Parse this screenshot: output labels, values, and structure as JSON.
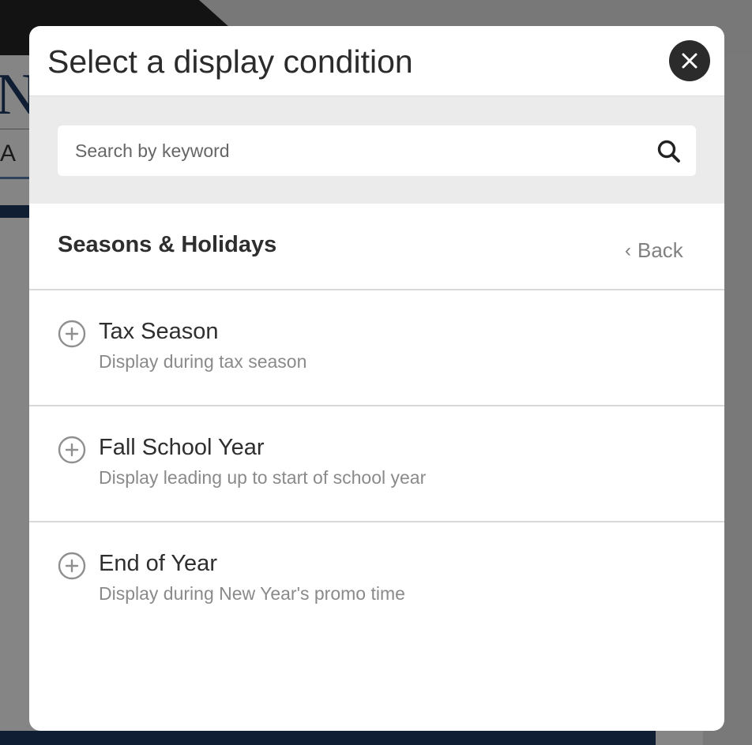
{
  "background": {
    "nav_letter": "A"
  },
  "modal": {
    "title": "Select a display condition",
    "close_icon": "close-icon",
    "search": {
      "placeholder": "Search by keyword",
      "value": "",
      "icon": "search-icon"
    },
    "section": {
      "title": "Seasons & Holidays",
      "back_label": "Back",
      "back_chevron": "‹"
    },
    "items": [
      {
        "name": "Tax Season",
        "description": "Display during tax season",
        "icon": "plus-circle-icon"
      },
      {
        "name": "Fall School Year",
        "description": "Display leading up to start of school year",
        "icon": "plus-circle-icon"
      },
      {
        "name": "End of Year",
        "description": "Display during New Year's promo time",
        "icon": "plus-circle-icon"
      }
    ]
  },
  "colors": {
    "overlay": "#7a7a7a",
    "title_text": "#2b2b2b",
    "close_button_bg": "#2b2b2b",
    "search_area_bg": "#ebebeb",
    "muted_text": "#8a8a8a",
    "brand_navy": "#1f3a63"
  }
}
